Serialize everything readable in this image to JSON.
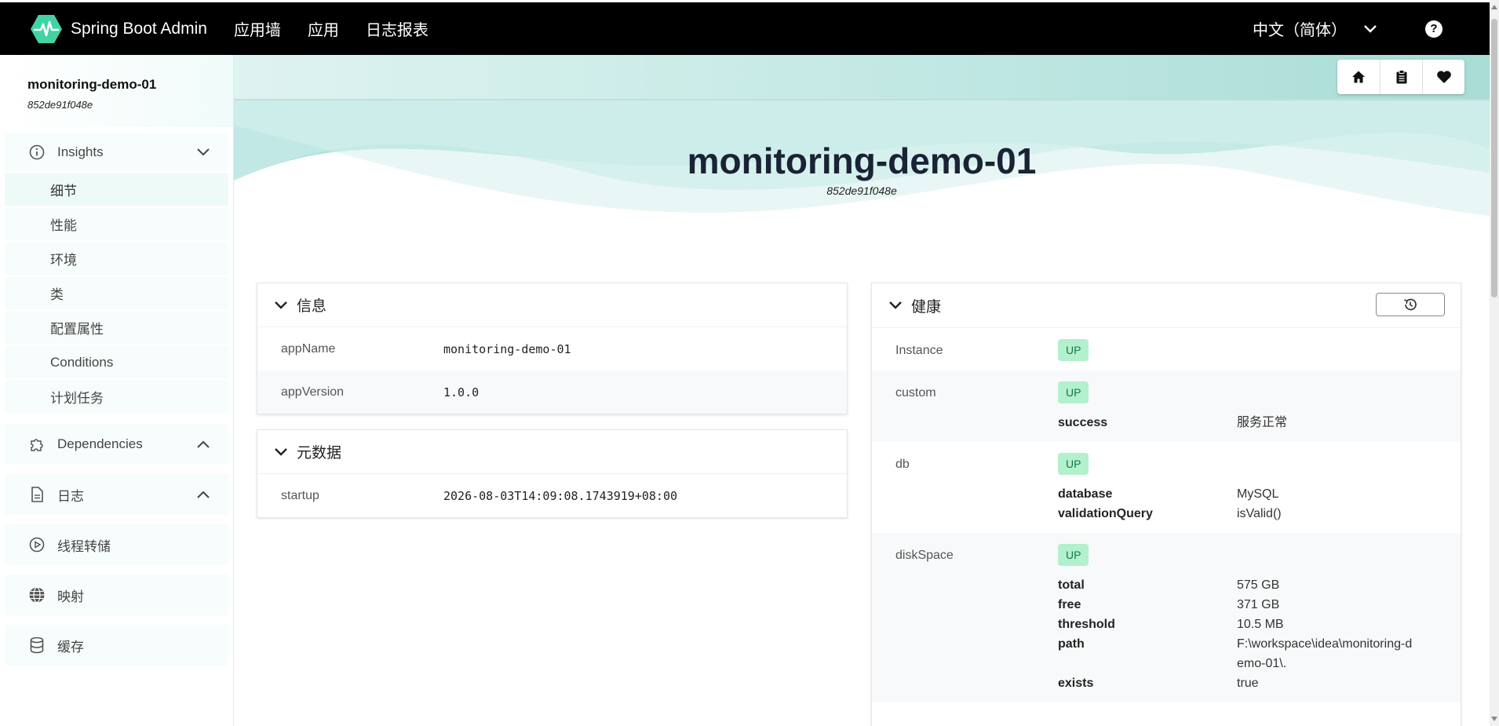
{
  "navbar": {
    "brand": "Spring Boot Admin",
    "items": [
      "应用墙",
      "应用",
      "日志报表"
    ],
    "language": "中文（简体）",
    "help_label": "?"
  },
  "sidebar": {
    "app_name": "monitoring-demo-01",
    "instance_id": "852de91f048e",
    "insights_label": "Insights",
    "insights_items": [
      "细节",
      "性能",
      "环境",
      "类",
      "配置属性",
      "Conditions",
      "计划任务"
    ],
    "dependencies_label": "Dependencies",
    "logs_label": "日志",
    "threaddump_label": "线程转储",
    "mappings_label": "映射",
    "caches_label": "缓存"
  },
  "hero": {
    "title": "monitoring-demo-01",
    "subtitle": "852de91f048e"
  },
  "info": {
    "title": "信息",
    "rows": [
      {
        "key": "appName",
        "value": "monitoring-demo-01"
      },
      {
        "key": "appVersion",
        "value": "1.0.0"
      }
    ]
  },
  "metadata": {
    "title": "元数据",
    "rows": [
      {
        "key": "startup",
        "value": "2026-08-03T14:09:08.1743919+08:00"
      }
    ]
  },
  "health": {
    "title": "健康",
    "instance": {
      "key": "Instance",
      "status": "UP"
    },
    "custom": {
      "key": "custom",
      "status": "UP",
      "details": [
        {
          "k": "success",
          "v": "服务正常"
        }
      ]
    },
    "db": {
      "key": "db",
      "status": "UP",
      "details": [
        {
          "k": "database",
          "v": "MySQL"
        },
        {
          "k": "validationQuery",
          "v": "isValid()"
        }
      ]
    },
    "diskSpace": {
      "key": "diskSpace",
      "status": "UP",
      "details": [
        {
          "k": "total",
          "v": "575 GB"
        },
        {
          "k": "free",
          "v": "371 GB"
        },
        {
          "k": "threshold",
          "v": "10.5 MB"
        },
        {
          "k": "path",
          "v": "F:\\workspace\\idea\\monitoring-demo-01\\."
        },
        {
          "k": "exists",
          "v": "true"
        }
      ]
    }
  },
  "colors": {
    "navbar": "#000000",
    "accent": "#42d3a5",
    "up_badge_bg": "#b3f0cd",
    "up_badge_text": "#117a46"
  }
}
